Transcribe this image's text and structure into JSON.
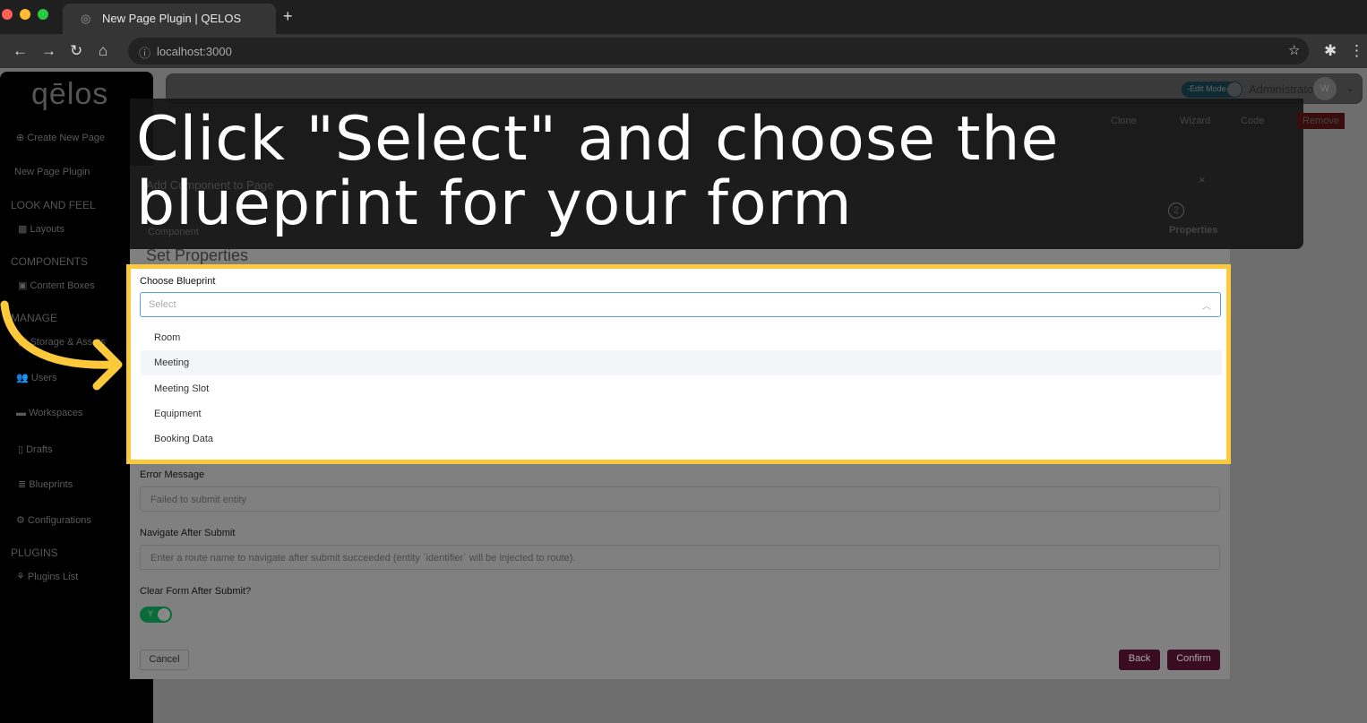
{
  "browser": {
    "tab_title": "New Page Plugin | QELOS",
    "url": "localhost:3000"
  },
  "sidebar": {
    "logo": "qēlos",
    "items": [
      {
        "label": "Create New Page"
      },
      {
        "label": "New Page Plugin"
      },
      {
        "label": "LOOK AND FEEL"
      },
      {
        "label": "Layouts"
      },
      {
        "label": "COMPONENTS"
      },
      {
        "label": "Content Boxes"
      },
      {
        "label": "MANAGE"
      },
      {
        "label": "Storage & Assets"
      },
      {
        "label": "Users"
      },
      {
        "label": "Workspaces"
      },
      {
        "label": "Drafts"
      },
      {
        "label": "Blueprints"
      },
      {
        "label": "Configurations"
      },
      {
        "label": "PLUGINS"
      },
      {
        "label": "Plugins List"
      }
    ]
  },
  "header": {
    "edit_mode": "-Edit Mode-",
    "user": "Administrator",
    "avatar": "W"
  },
  "toolbar": {
    "clone": "Clone",
    "wizard": "Wizard",
    "code": "Code",
    "remove": "Remove"
  },
  "caption": {
    "line1": "Click \"Select\" and choose the",
    "line2": "blueprint for your form"
  },
  "modal": {
    "title": "Add Component to Page",
    "step1": "Component",
    "step2_num": "2",
    "step2": "Properties",
    "section": "Set Properties",
    "blueprint_label": "Choose Blueprint",
    "blueprint_placeholder": "Select",
    "options": [
      "Room",
      "Meeting",
      "Meeting Slot",
      "Equipment",
      "Booking Data"
    ],
    "error_label": "Error Message",
    "error_placeholder": "Failed to submit entity",
    "navigate_label": "Navigate After Submit",
    "navigate_placeholder": "Enter a route name to navigate after submit succeeded (entity `identifier` will be injected to route).",
    "clear_label": "Clear Form After Submit?",
    "clear_toggle": "Y",
    "clear_value": true,
    "cancel": "Cancel",
    "back": "Back",
    "confirm": "Confirm"
  },
  "colors": {
    "highlight": "#fcc93a",
    "primary": "#4a1030",
    "toggle_on": "#0a6b3a"
  }
}
